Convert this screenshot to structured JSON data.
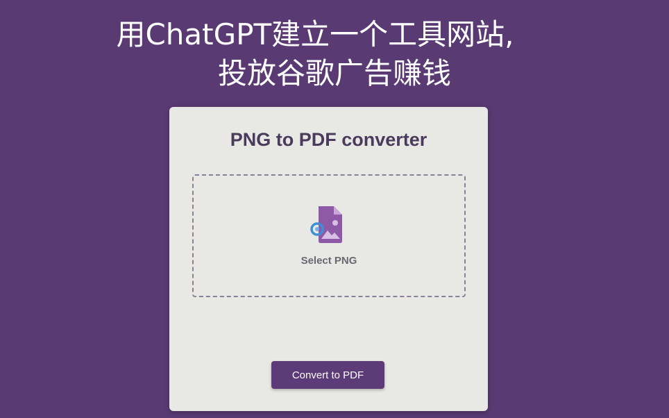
{
  "caption": {
    "line1": "用ChatGPT建立一个工具网站,",
    "line2": "投放谷歌广告赚钱"
  },
  "converter": {
    "title": "PNG to PDF converter",
    "select_label": "Select PNG",
    "convert_label": "Convert to PDF",
    "icon": "image-file-icon"
  },
  "colors": {
    "background": "#5a3a73",
    "card": "#e8e9e4",
    "accent": "#5d3b78",
    "icon_file": "#8e5aa8",
    "icon_ring": "#3f8fd6"
  }
}
